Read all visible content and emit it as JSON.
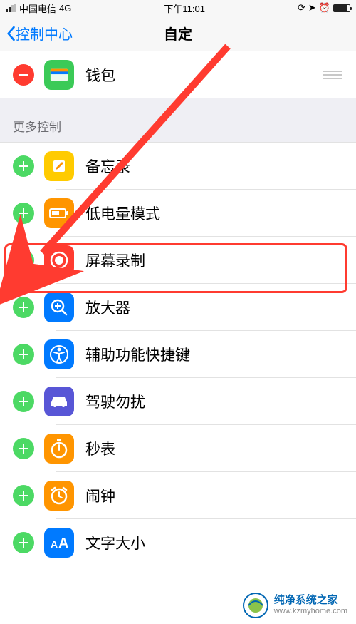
{
  "statusbar": {
    "carrier": "中国电信",
    "network": "4G",
    "time": "下午11:01"
  },
  "navbar": {
    "back": "控制中心",
    "title": "自定"
  },
  "included": [
    {
      "label": "钱包",
      "icon": "wallet"
    }
  ],
  "section_more_header": "更多控制",
  "more": [
    {
      "label": "备忘录",
      "icon": "notes"
    },
    {
      "label": "低电量模式",
      "icon": "lowpower"
    },
    {
      "label": "屏幕录制",
      "icon": "screenrec"
    },
    {
      "label": "放大器",
      "icon": "magnify"
    },
    {
      "label": "辅助功能快捷键",
      "icon": "access"
    },
    {
      "label": "驾驶勿扰",
      "icon": "drive"
    },
    {
      "label": "秒表",
      "icon": "stopwatch"
    },
    {
      "label": "闹钟",
      "icon": "alarm"
    },
    {
      "label": "文字大小",
      "icon": "textsize"
    }
  ],
  "watermark": {
    "title": "纯净系统之家",
    "url": "www.kzmyhome.com"
  }
}
